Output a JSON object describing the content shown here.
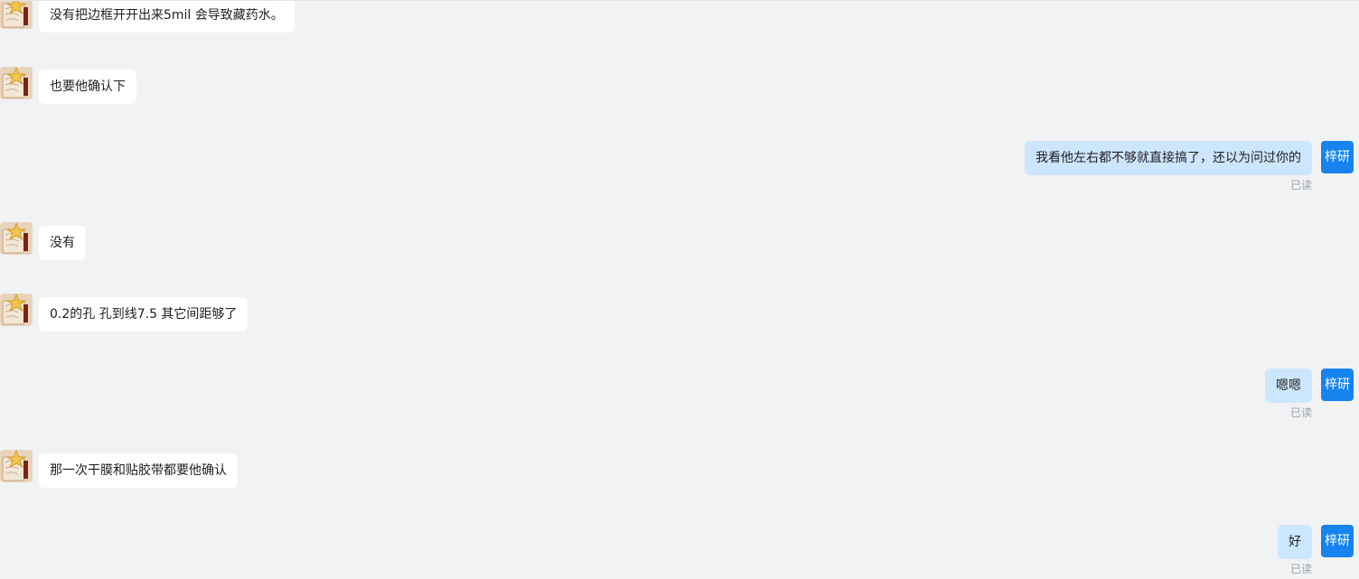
{
  "colors": {
    "background": "#f1f2f4",
    "incoming_bubble": "#ffffff",
    "outgoing_bubble": "#cde6ff",
    "self_avatar": "#1683ef",
    "read_text": "#9aa0a6"
  },
  "contact": {
    "avatar_icon": "parchment-star-avatar"
  },
  "self": {
    "avatar_label": "梓研"
  },
  "messages": [
    {
      "text": "没有把边框开开出来5mil 会导致藏药水。"
    },
    {
      "text": "也要他确认下"
    },
    {
      "text": "我看他左右都不够就直接搞了，还以为问过你的",
      "status": "已读"
    },
    {
      "text": "没有"
    },
    {
      "text": "0.2的孔 孔到线7.5 其它间距够了"
    },
    {
      "text": "嗯嗯",
      "status": "已读"
    },
    {
      "text": "那一次干膜和贴胶带都要他确认"
    },
    {
      "text": "好",
      "status": "已读"
    }
  ]
}
